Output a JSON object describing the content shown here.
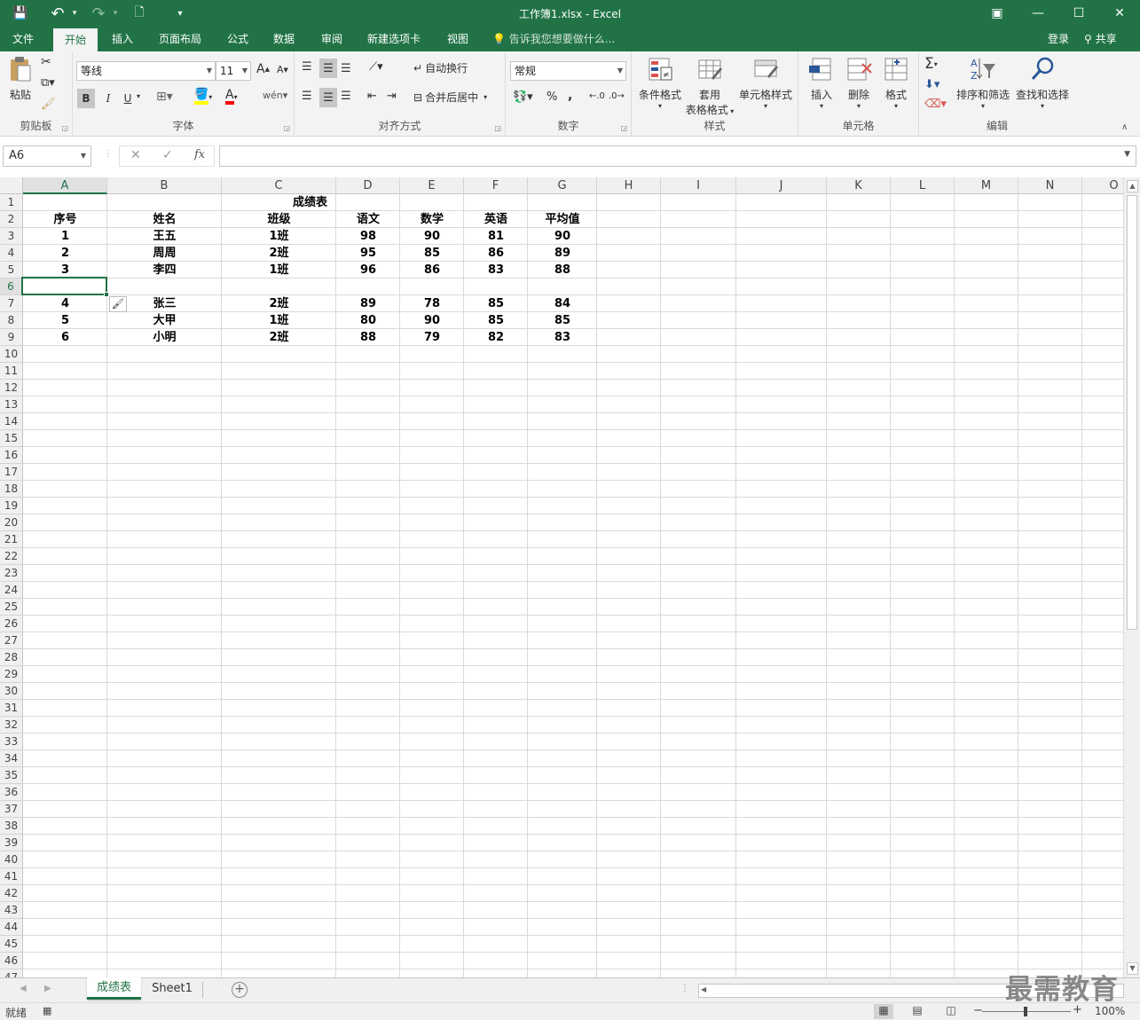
{
  "window": {
    "title": "工作簿1.xlsx - Excel",
    "controls": {
      "ribbon_opts": "▣",
      "minimize": "—",
      "maximize": "☐",
      "close": "✕"
    }
  },
  "quick_access": {
    "save": "💾",
    "undo": "↶",
    "redo": "↷",
    "new": "🗋",
    "customize": "▾"
  },
  "menu": {
    "tabs": [
      "文件",
      "开始",
      "插入",
      "页面布局",
      "公式",
      "数据",
      "审阅",
      "新建选项卡",
      "视图"
    ],
    "active": "开始",
    "tell_me": "告诉我您想要做什么...",
    "login": "登录",
    "share": "共享"
  },
  "ribbon": {
    "clipboard": {
      "label": "剪贴板",
      "paste": "粘贴"
    },
    "font": {
      "label": "字体",
      "name": "等线",
      "size": "11",
      "bold": "B",
      "italic": "I",
      "underline": "U",
      "grow": "A",
      "shrink": "A",
      "fill_color": "#ffff00",
      "font_color": "#ff0000"
    },
    "alignment": {
      "label": "对齐方式",
      "wrap": "自动换行",
      "merge": "合并后居中"
    },
    "number": {
      "label": "数字",
      "format": "常规",
      "percent": "%",
      "comma": ","
    },
    "styles": {
      "label": "样式",
      "conditional": "条件格式",
      "table_line1": "套用",
      "table_line2": "表格格式",
      "cell_styles": "单元格样式"
    },
    "cells": {
      "label": "单元格",
      "insert": "插入",
      "delete": "删除",
      "format": "格式"
    },
    "editing": {
      "label": "编辑",
      "sort": "排序和筛选",
      "find": "查找和选择",
      "sum": "Σ"
    }
  },
  "formula_bar": {
    "name_box": "A6",
    "cancel": "✕",
    "enter": "✓",
    "fx": "fx",
    "value": ""
  },
  "sheet": {
    "columns": [
      "A",
      "B",
      "C",
      "D",
      "E",
      "F",
      "G",
      "H",
      "I",
      "J",
      "K",
      "L",
      "M",
      "N",
      "O"
    ],
    "selected_cell": "A6",
    "title": "成绩表",
    "header": [
      "序号",
      "姓名",
      "班级",
      "语文",
      "数学",
      "英语",
      "平均值"
    ],
    "rows": [
      [
        "1",
        "王五",
        "1班",
        "98",
        "90",
        "81",
        "90"
      ],
      [
        "2",
        "周周",
        "2班",
        "95",
        "85",
        "86",
        "89"
      ],
      [
        "3",
        "李四",
        "1班",
        "96",
        "86",
        "83",
        "88"
      ],
      [
        "",
        "",
        "",
        "",
        "",
        "",
        ""
      ],
      [
        "4",
        "张三",
        "2班",
        "89",
        "78",
        "85",
        "84"
      ],
      [
        "5",
        "大甲",
        "1班",
        "80",
        "90",
        "85",
        "85"
      ],
      [
        "6",
        "小明",
        "2班",
        "88",
        "79",
        "82",
        "83"
      ]
    ],
    "row_count": 47
  },
  "sheet_tabs": {
    "tabs": [
      "成绩表",
      "Sheet1"
    ],
    "active": "成绩表",
    "add": "+"
  },
  "status_bar": {
    "ready": "就绪",
    "zoom": "100%",
    "zoom_minus": "−",
    "zoom_plus": "+"
  },
  "watermark": "最需教育",
  "colors": {
    "accent": "#217346",
    "ribbon_bg": "#f3f3f3"
  }
}
